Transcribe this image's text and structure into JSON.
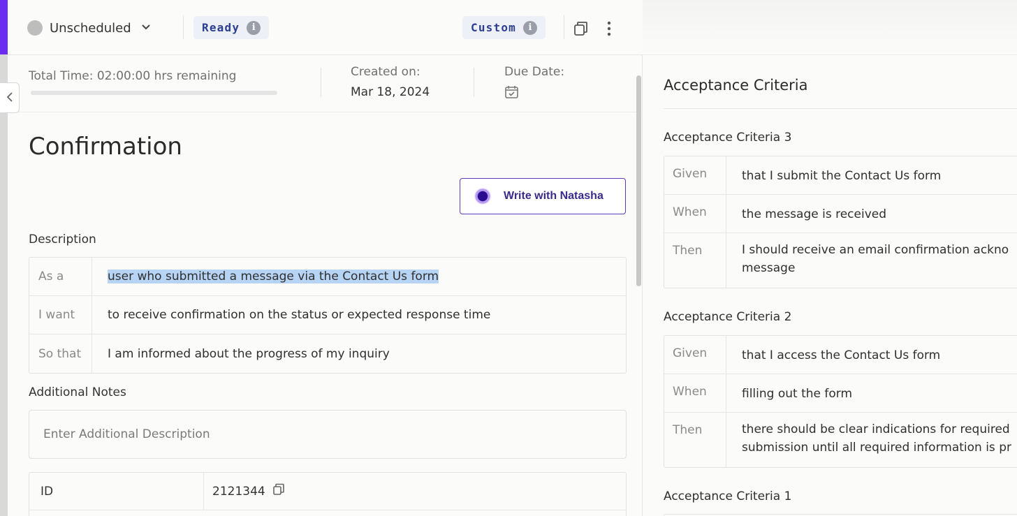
{
  "header": {
    "status_label": "Unscheduled",
    "ready_label": "Ready",
    "custom_label": "Custom",
    "info_glyph": "i"
  },
  "meta": {
    "total_time": "Total Time: 02:00:00 hrs remaining",
    "progress_fraction": 0,
    "created_label": "Created on:",
    "created_value": "Mar 18, 2024",
    "due_label": "Due Date:"
  },
  "story": {
    "title": "Confirmation",
    "natasha_button": "Write with Natasha",
    "description_label": "Description",
    "description_rows": [
      {
        "key": "As a",
        "value": "user who submitted a message via the Contact Us form"
      },
      {
        "key": "I want",
        "value": "to receive confirmation on the status or expected response time"
      },
      {
        "key": "So that",
        "value": "I am informed about the progress of my inquiry"
      }
    ],
    "notes_label": "Additional Notes",
    "notes_placeholder": "Enter Additional Description",
    "id_label": "ID",
    "id_value": "2121344"
  },
  "acceptance": {
    "heading": "Acceptance Criteria",
    "criteria": [
      {
        "title": "Acceptance Criteria 3",
        "rows": [
          {
            "key": "Given",
            "value": "that I submit the Contact Us form"
          },
          {
            "key": "When",
            "value": "the message is received"
          },
          {
            "key": "Then",
            "value": "I should receive an email confirmation ackno",
            "value2": "message"
          }
        ]
      },
      {
        "title": "Acceptance Criteria 2",
        "rows": [
          {
            "key": "Given",
            "value": "that I access the Contact Us form"
          },
          {
            "key": "When",
            "value": "filling out the form"
          },
          {
            "key": "Then",
            "value": "there should be clear indications for required",
            "value2": "submission until all required information is pr"
          }
        ]
      },
      {
        "title": "Acceptance Criteria 1"
      }
    ]
  },
  "colors": {
    "accent": "#6b2df0",
    "badge_text": "#2b3f91",
    "natasha": "#5d3bb8",
    "highlight": "#b8d4f5"
  }
}
